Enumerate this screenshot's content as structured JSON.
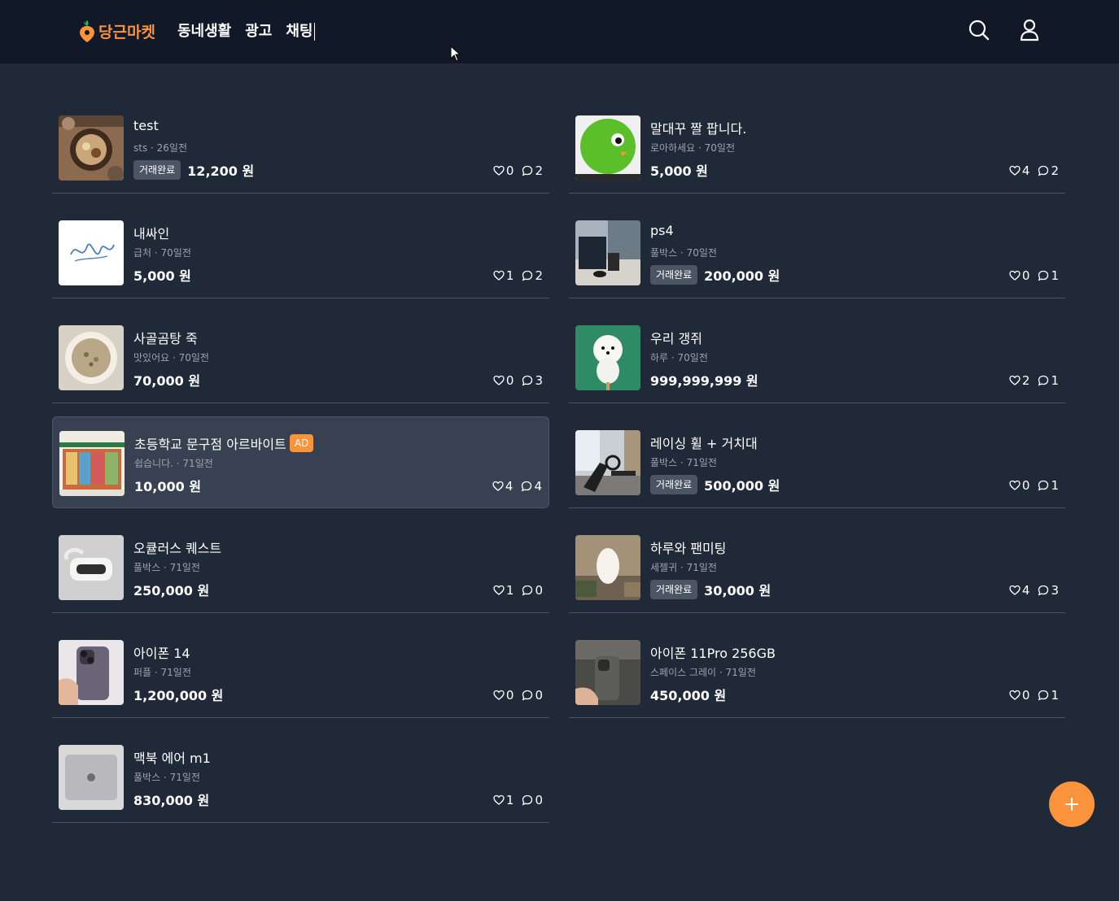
{
  "header": {
    "brand": "당근마켓",
    "nav": [
      "동네생활",
      "광고",
      "채팅"
    ],
    "icons": [
      "search-icon",
      "user-icon"
    ]
  },
  "colors": {
    "accent": "#fb923c",
    "background": "#1f2937",
    "topbar": "#111827",
    "badge": "#4b5563"
  },
  "left_items": [
    {
      "title": "test",
      "meta": "sts · 26일전",
      "status": "거래완료",
      "price": "12,200 원",
      "likes": "0",
      "comments": "2",
      "ad": ""
    },
    {
      "title": "내싸인",
      "meta": "급처 · 70일전",
      "status": "",
      "price": "5,000 원",
      "likes": "1",
      "comments": "2",
      "ad": ""
    },
    {
      "title": "사골곰탕 죽",
      "meta": "맛있어요 · 70일전",
      "status": "",
      "price": "70,000 원",
      "likes": "0",
      "comments": "3",
      "ad": ""
    },
    {
      "title": "초등학교 문구점 아르바이트",
      "meta": "쉽습니다. · 71일전",
      "status": "",
      "price": "10,000 원",
      "likes": "4",
      "comments": "4",
      "ad": "AD"
    },
    {
      "title": "오큘러스 퀘스트",
      "meta": "풀박스 · 71일전",
      "status": "",
      "price": "250,000 원",
      "likes": "1",
      "comments": "0",
      "ad": ""
    },
    {
      "title": "아이폰 14",
      "meta": "퍼플 · 71일전",
      "status": "",
      "price": "1,200,000 원",
      "likes": "0",
      "comments": "0",
      "ad": ""
    },
    {
      "title": "맥북 에어 m1",
      "meta": "풀박스 · 71일전",
      "status": "",
      "price": "830,000 원",
      "likes": "1",
      "comments": "0",
      "ad": ""
    }
  ],
  "right_items": [
    {
      "title": "말대꾸 짤 팝니다.",
      "meta": "로아하세요 · 70일전",
      "status": "",
      "price": "5,000 원",
      "likes": "4",
      "comments": "2"
    },
    {
      "title": "ps4",
      "meta": "풀박스 · 70일전",
      "status": "거래완료",
      "price": "200,000 원",
      "likes": "0",
      "comments": "1"
    },
    {
      "title": "우리 갱쥐",
      "meta": "하루 · 70일전",
      "status": "",
      "price": "999,999,999 원",
      "likes": "2",
      "comments": "1"
    },
    {
      "title": "레이싱 휠 + 거치대",
      "meta": "풀박스 · 71일전",
      "status": "거래완료",
      "price": "500,000 원",
      "likes": "0",
      "comments": "1"
    },
    {
      "title": "하루와 팬미팅",
      "meta": "세젤귀 · 71일전",
      "status": "거래완료",
      "price": "30,000 원",
      "likes": "4",
      "comments": "3"
    },
    {
      "title": "아이폰 11Pro 256GB",
      "meta": "스페이스 그레이 · 71일전",
      "status": "",
      "price": "450,000 원",
      "likes": "0",
      "comments": "1"
    }
  ],
  "fab": {
    "icon": "plus-icon"
  }
}
